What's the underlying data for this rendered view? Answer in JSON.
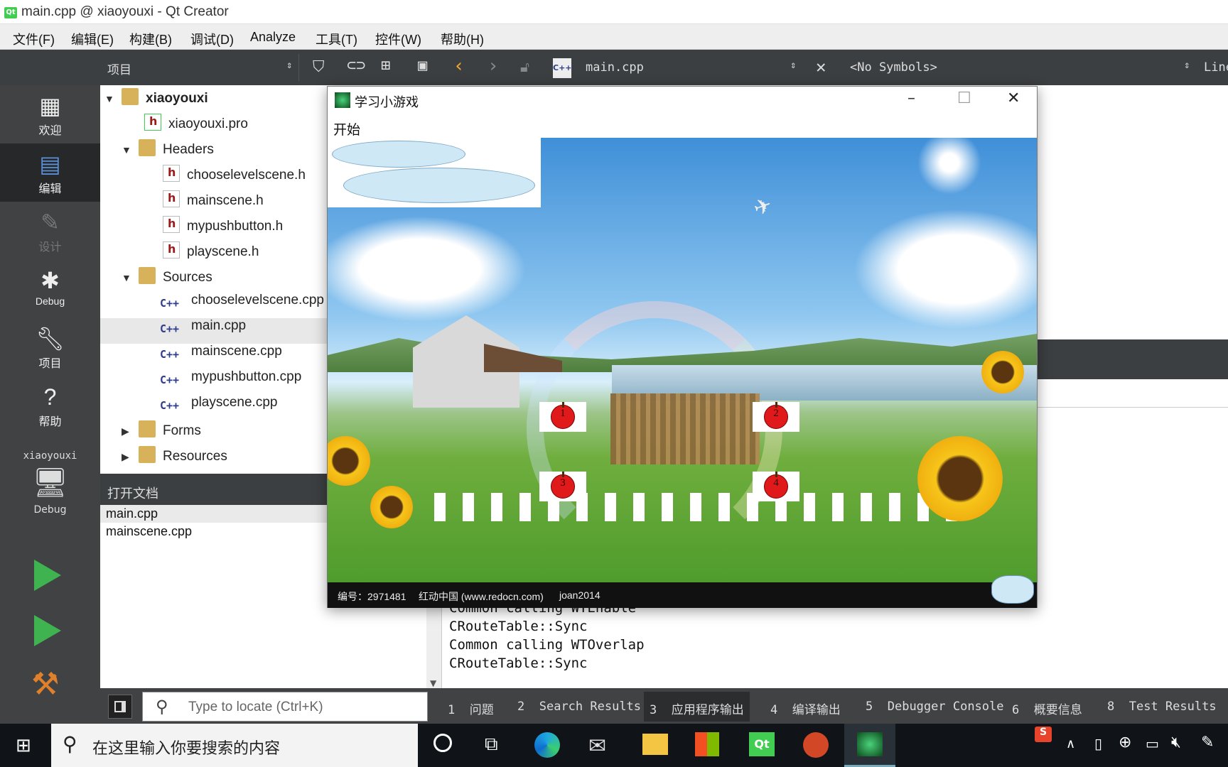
{
  "window": {
    "title": "main.cpp @ xiaoyouxi - Qt Creator",
    "app_badge": "Qt"
  },
  "menu": [
    "文件(F)",
    "编辑(E)",
    "构建(B)",
    "调试(D)",
    "Analyze",
    "工具(T)",
    "控件(W)",
    "帮助(H)"
  ],
  "toolbar": {
    "project_combo": "项目",
    "file_combo": "main.cpp",
    "file_badge": "C++",
    "symbols": "<No Symbols>",
    "line_label": "Line"
  },
  "modes": [
    {
      "label": "欢迎",
      "icon": "grid-icon"
    },
    {
      "label": "编辑",
      "icon": "edit-icon"
    },
    {
      "label": "设计",
      "icon": "pen-icon"
    },
    {
      "label": "Debug",
      "icon": "bug-icon"
    },
    {
      "label": "项目",
      "icon": "wrench-icon"
    },
    {
      "label": "帮助",
      "icon": "help-icon"
    }
  ],
  "kit": {
    "project": "xiaoyouxi",
    "config": "Debug"
  },
  "tree": {
    "root": "xiaoyouxi",
    "pro": "xiaoyouxi.pro",
    "headers": "Headers",
    "header_files": [
      "chooselevelscene.h",
      "mainscene.h",
      "mypushbutton.h",
      "playscene.h"
    ],
    "sources": "Sources",
    "source_files": [
      "chooselevelscene.cpp",
      "main.cpp",
      "mainscene.cpp",
      "mypushbutton.cpp",
      "playscene.cpp"
    ],
    "forms": "Forms",
    "resources": "Resources",
    "cpp_badge": "C++",
    "qt_badge": "Qt"
  },
  "open_docs": {
    "header": "打开文档",
    "files": [
      "main.cpp",
      "mainscene.cpp"
    ]
  },
  "output_lines": [
    "Common calling WTEnable",
    "CRouteTable::Sync",
    "Common calling WTOverlap",
    "CRouteTable::Sync"
  ],
  "locate_placeholder": "Type to locate (Ctrl+K)",
  "panes": [
    {
      "n": "1",
      "label": "问题"
    },
    {
      "n": "2",
      "label": "Search Results"
    },
    {
      "n": "3",
      "label": "应用程序输出"
    },
    {
      "n": "4",
      "label": "编译输出"
    },
    {
      "n": "5",
      "label": "Debugger Console"
    },
    {
      "n": "6",
      "label": "概要信息"
    },
    {
      "n": "8",
      "label": "Test Results"
    }
  ],
  "game": {
    "title": "学习小游戏",
    "menu_start": "开始",
    "levels": [
      "1",
      "2",
      "3",
      "4"
    ],
    "watermark_id": "编号：2971481",
    "watermark_site": "红动中国 (www.redocn.com)",
    "watermark_user": "joan2014"
  },
  "taskbar": {
    "search_placeholder": "在这里输入你要搜索的内容",
    "input_method": "S"
  },
  "colors": {
    "ide_dark": "#3c3f41",
    "sidebar": "#404244",
    "accent_green": "#41cd52",
    "taskbar": "#101418"
  }
}
